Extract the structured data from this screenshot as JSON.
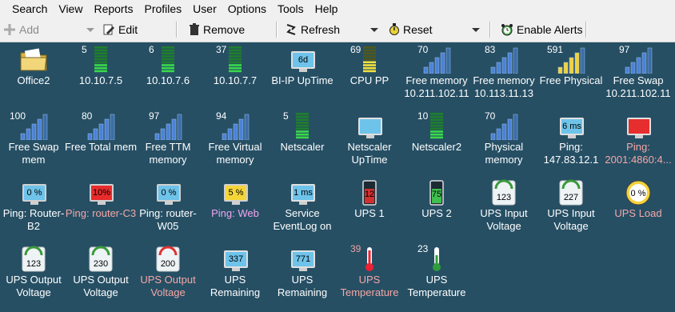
{
  "menu": [
    "Search",
    "View",
    "Reports",
    "Profiles",
    "User",
    "Options",
    "Tools",
    "Help"
  ],
  "toolbar": {
    "add_label": "Add",
    "edit_label": "Edit",
    "remove_label": "Remove",
    "refresh_label": "Refresh",
    "reset_label": "Reset",
    "alerts_label": "Enable Alerts"
  },
  "tiles": [
    {
      "label": "Office2",
      "value": "",
      "icon": "folder-icon"
    },
    {
      "label": "10.10.7.5",
      "value": "5",
      "icon": "green-bars-icon"
    },
    {
      "label": "10.10.7.6",
      "value": "6",
      "icon": "green-bars-icon"
    },
    {
      "label": "10.10.7.7",
      "value": "37",
      "icon": "green-bars-icon"
    },
    {
      "label": "BI-IP UpTime",
      "value": "",
      "icon": "monitor-icon",
      "screen": "6d"
    },
    {
      "label": "CPU PP",
      "value": "69",
      "icon": "yellow-bars-icon"
    },
    {
      "label": "Free memory 10.211.102.11",
      "value": "70",
      "icon": "signal-bars-icon"
    },
    {
      "label": "Free memory 10.113.11.13",
      "value": "83",
      "icon": "signal-bars-icon"
    },
    {
      "label": "Free Physical",
      "value": "591",
      "icon": "signal-bars-yellow-icon"
    },
    {
      "label": "Free Swap 10.211.102.11",
      "value": "97",
      "icon": "signal-bars-icon"
    },
    {
      "label": "Free Swap mem",
      "value": "100",
      "icon": "signal-bars-icon"
    },
    {
      "label": "Free Total mem",
      "value": "80",
      "icon": "signal-bars-icon"
    },
    {
      "label": "Free TTM memory",
      "value": "97",
      "icon": "signal-bars-icon"
    },
    {
      "label": "Free Virtual memory",
      "value": "94",
      "icon": "signal-bars-icon"
    },
    {
      "label": "Netscaler",
      "value": "5",
      "icon": "green-bars-icon"
    },
    {
      "label": "Netscaler UpTime",
      "value": "",
      "icon": "monitor-icon",
      "screen": ""
    },
    {
      "label": "Netscaler2",
      "value": "10",
      "icon": "green-bars-icon"
    },
    {
      "label": "Physical memory",
      "value": "70",
      "icon": "signal-bars-icon"
    },
    {
      "label": "Ping: 147.83.12.1",
      "value": "",
      "icon": "monitor-icon",
      "screen": "6 ms"
    },
    {
      "label": "Ping: 2001:4860:4...",
      "value": "",
      "icon": "monitor-red-icon",
      "screen": "",
      "color": "pink"
    },
    {
      "label": "Ping: Router-B2",
      "value": "",
      "icon": "gauge-icon",
      "screen": "0 %"
    },
    {
      "label": "Ping: router-C3",
      "value": "",
      "icon": "gauge-red-icon",
      "screen": "10%",
      "color": "pink"
    },
    {
      "label": "Ping: router-W05",
      "value": "",
      "icon": "gauge-icon",
      "screen": "0 %"
    },
    {
      "label": "Ping: Web",
      "value": "",
      "icon": "gauge-yellow-icon",
      "screen": "5 %",
      "color": "magenta"
    },
    {
      "label": "Service EventLog on",
      "value": "",
      "icon": "monitor-icon",
      "screen": "1 ms"
    },
    {
      "label": "UPS 1",
      "value": "",
      "icon": "battery-icon",
      "screen": "12"
    },
    {
      "label": "UPS 2",
      "value": "",
      "icon": "battery-green-icon",
      "screen": "75"
    },
    {
      "label": "UPS Input Voltage",
      "value": "",
      "icon": "meter-icon",
      "screen": "123"
    },
    {
      "label": "UPS Input Voltage",
      "value": "",
      "icon": "meter-icon",
      "screen": "227"
    },
    {
      "label": "UPS Load",
      "value": "",
      "icon": "dial-icon",
      "screen": "0 %",
      "color": "pink"
    },
    {
      "label": "UPS Output Voltage",
      "value": "",
      "icon": "meter-icon",
      "screen": "123"
    },
    {
      "label": "UPS Output Voltage",
      "value": "",
      "icon": "meter-icon",
      "screen": "230"
    },
    {
      "label": "UPS Output Voltage",
      "value": "",
      "icon": "meter-icon",
      "screen": "200",
      "color": "pink"
    },
    {
      "label": "UPS Remaining",
      "value": "",
      "icon": "monitor-icon",
      "screen": "337"
    },
    {
      "label": "UPS Remaining",
      "value": "",
      "icon": "monitor-icon",
      "screen": "771"
    },
    {
      "label": "UPS Temperature",
      "value": "39",
      "icon": "thermometer-red-icon",
      "color": "pink"
    },
    {
      "label": "UPS Temperature",
      "value": "23",
      "icon": "thermometer-green-icon"
    }
  ]
}
